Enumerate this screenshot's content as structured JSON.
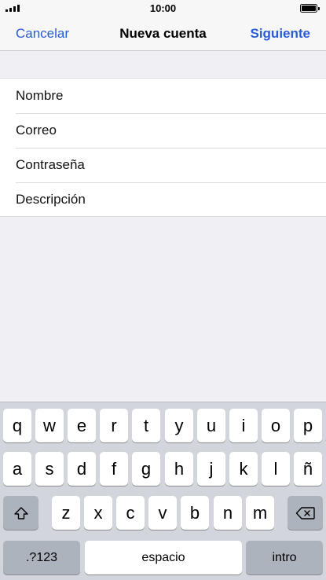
{
  "status_bar": {
    "time": "10:00"
  },
  "nav": {
    "cancel_label": "Cancelar",
    "title": "Nueva cuenta",
    "next_label": "Siguiente"
  },
  "form": {
    "fields": [
      {
        "placeholder": "Nombre"
      },
      {
        "placeholder": "Correo"
      },
      {
        "placeholder": "Contraseña"
      },
      {
        "placeholder": "Descripción"
      }
    ]
  },
  "keyboard": {
    "row1": [
      "q",
      "w",
      "e",
      "r",
      "t",
      "y",
      "u",
      "i",
      "o",
      "p"
    ],
    "row2": [
      "a",
      "s",
      "d",
      "f",
      "g",
      "h",
      "j",
      "k",
      "l",
      "ñ"
    ],
    "row3": [
      "z",
      "x",
      "c",
      "v",
      "b",
      "n",
      "m"
    ],
    "numbers_label": ".?123",
    "space_label": "espacio",
    "return_label": "intro",
    "shift_icon": "shift-icon",
    "delete_icon": "delete-icon"
  },
  "colors": {
    "accent": "#2a5bd7",
    "background": "#efeff4",
    "keyboard": "#d2d5db",
    "function_key": "#adb3bc"
  }
}
